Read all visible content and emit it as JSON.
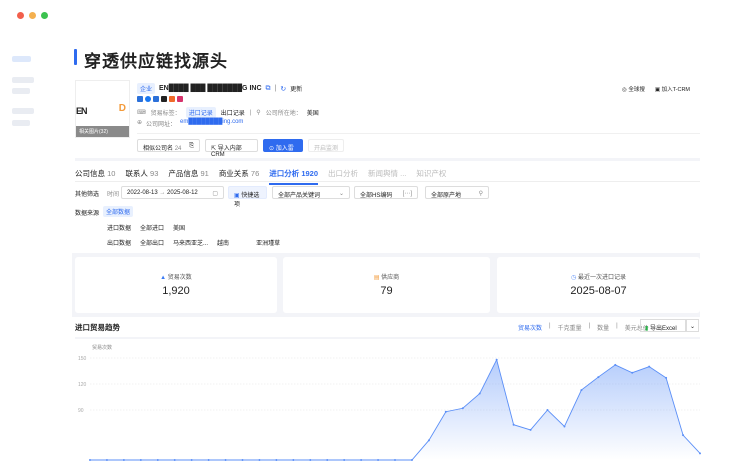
{
  "window": {
    "controls": [
      "#f25f4c",
      "#f4b04f",
      "#3cc24f"
    ]
  },
  "page_title": "穿透供应链找源头",
  "company": {
    "type_tag": "企业",
    "name": "EN████ ███ ███████G INC",
    "refresh": "更新",
    "logo_text": "EN",
    "logo_caption": "相关图片(32)",
    "trade_label": "贸易标签：",
    "import_tag": "进口记录",
    "export_tag": "出口记录",
    "location_label": "公司所在地：",
    "location": "美国",
    "website_label": "公司网址：",
    "website": "em████████ing.com",
    "social_icons": [
      "linkedin-icon",
      "facebook-icon",
      "linkedin-icon",
      "x-icon",
      "phone-icon",
      "instagram-icon"
    ]
  },
  "top_actions": {
    "global_search": "全球搜",
    "add_crm": "加入T-CRM"
  },
  "buttons": {
    "similar": "相似公司名",
    "similar_count": "24",
    "import_crm": "导入内部CRM",
    "add_radar": "加入雷达",
    "monitor": "开启监测"
  },
  "tabs": [
    {
      "label": "公司信息",
      "count": "10"
    },
    {
      "label": "联系人",
      "count": "93"
    },
    {
      "label": "产品信息",
      "count": "91"
    },
    {
      "label": "商业关系",
      "count": "76"
    },
    {
      "label": "进口分析",
      "count": "1920",
      "active": true
    },
    {
      "label": "出口分析",
      "count": "",
      "disabled": true
    },
    {
      "label": "新闻舆情 ...",
      "count": "",
      "disabled": true
    },
    {
      "label": "知识产权",
      "count": "",
      "disabled": true
    }
  ],
  "filters": {
    "label": "其他筛选",
    "time_label": "时间",
    "start": "2022-08-13",
    "arrow": "→",
    "end": "2025-08-12",
    "quick": "快捷选项",
    "product": "全部产品关键词",
    "hs": "全部HS编码",
    "origin": "全部原产地"
  },
  "data_source": {
    "label": "数据来源",
    "all": "全部数据",
    "import_row": [
      "进口数据",
      "全部进口",
      "美国"
    ],
    "export_row": [
      "出口数据",
      "全部出口",
      "马来西亚芝...",
      "越南",
      "亚洲瑾草"
    ]
  },
  "stats": [
    {
      "label": "贸易次数",
      "value": "1,920",
      "icon": "trade-icon",
      "color": "#3b7cf5"
    },
    {
      "label": "供应商",
      "value": "79",
      "icon": "supplier-icon",
      "color": "#f39b3c"
    },
    {
      "label": "最近一次进口记录",
      "value": "2025-08-07",
      "icon": "clock-icon",
      "color": "#5b8ff7"
    }
  ],
  "trend": {
    "title": "进口贸易趋势",
    "metrics": [
      "贸易次数",
      "千克重量",
      "数量",
      "美元总价"
    ],
    "active_metric": "贸易次数",
    "export": "导出Excel"
  },
  "chart_data": {
    "type": "area",
    "ylabel": "贸易次数",
    "y_ticks": [
      "150",
      "120",
      "90"
    ],
    "ylim": [
      0,
      150
    ],
    "grid": true,
    "color": "#5b8ff7",
    "values": [
      30,
      30,
      30,
      30,
      30,
      30,
      30,
      30,
      30,
      30,
      30,
      30,
      30,
      30,
      30,
      30,
      30,
      30,
      30,
      30,
      55,
      88,
      92,
      109,
      148,
      73,
      67,
      90,
      71,
      113,
      128,
      142,
      133,
      140,
      127,
      61,
      40
    ]
  }
}
